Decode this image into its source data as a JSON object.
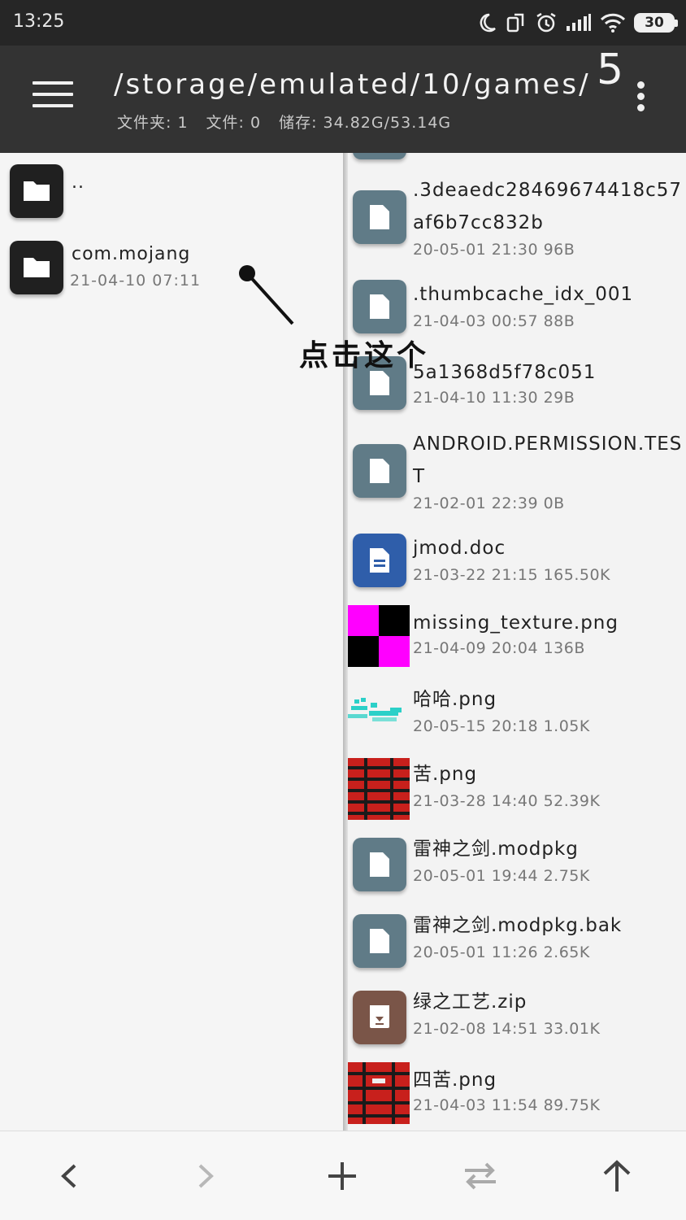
{
  "status_bar": {
    "time": "13:25",
    "battery": "30",
    "icons": [
      "moon-icon",
      "screen-rotate-icon",
      "alarm-icon",
      "signal-icon",
      "wifi-icon",
      "battery-icon"
    ]
  },
  "app_bar": {
    "path": "/storage/emulated/10/games/",
    "folders_label": "文件夹: 1",
    "files_label": "文件: 0",
    "storage_label": "储存: 34.82G/53.14G",
    "corner_number": "5"
  },
  "left_pane": {
    "items": [
      {
        "name": "..",
        "date": ""
      },
      {
        "name": "com.mojang",
        "date": "21-04-10 07:11"
      }
    ]
  },
  "annotation": {
    "text": "点击这个"
  },
  "right_pane": {
    "items": [
      {
        "name": ".3deaedc28469674418c57af6b7cc832b",
        "meta": "20-05-01 21:30  96B",
        "icon": "file-icon"
      },
      {
        "name": ".thumbcache_idx_001",
        "meta": "21-04-03 00:57  88B",
        "icon": "file-icon"
      },
      {
        "name": "5a1368d5f78c051",
        "meta": "21-04-10 11:30  29B",
        "icon": "file-icon"
      },
      {
        "name": "ANDROID.PERMISSION.TEST",
        "meta": "21-02-01 22:39  0B",
        "icon": "file-icon"
      },
      {
        "name": "jmod.doc",
        "meta": "21-03-22 21:15  165.50K",
        "icon": "document-icon"
      },
      {
        "name": "missing_texture.png",
        "meta": "21-04-09 20:04  136B",
        "icon": "image-thumbnail"
      },
      {
        "name": "哈哈.png",
        "meta": "20-05-15 20:18  1.05K",
        "icon": "image-thumbnail"
      },
      {
        "name": "苦.png",
        "meta": "21-03-28 14:40  52.39K",
        "icon": "image-thumbnail"
      },
      {
        "name": "雷神之剑.modpkg",
        "meta": "20-05-01 19:44  2.75K",
        "icon": "file-icon"
      },
      {
        "name": "雷神之剑.modpkg.bak",
        "meta": "20-05-01 11:26  2.65K",
        "icon": "file-icon"
      },
      {
        "name": "绿之工艺.zip",
        "meta": "21-02-08 14:51  33.01K",
        "icon": "archive-icon"
      },
      {
        "name": "四苦.png",
        "meta": "21-04-03 11:54  89.75K",
        "icon": "image-thumbnail"
      }
    ]
  },
  "bottom_bar": {
    "buttons": [
      "back-icon",
      "forward-icon",
      "add-icon",
      "swap-icon",
      "up-arrow-icon"
    ]
  },
  "colors": {
    "app_bar": "#333333",
    "status_bar": "#262626",
    "file_icon": "#607b87",
    "doc_icon": "#2f5eaa",
    "zip_icon": "#7a5548",
    "magenta": "#ff00ff",
    "thumb_red": "#c8201c"
  }
}
